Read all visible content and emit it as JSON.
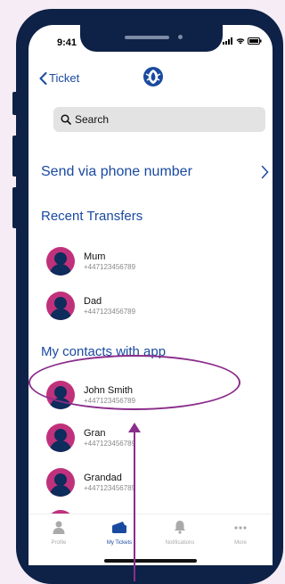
{
  "status": {
    "time": "9:41"
  },
  "nav": {
    "back_label": "Ticket"
  },
  "search": {
    "label": "Search"
  },
  "send_phone": {
    "label": "Send via phone number"
  },
  "recent": {
    "title": "Recent Transfers",
    "items": [
      {
        "name": "Mum",
        "phone": "+447123456789"
      },
      {
        "name": "Dad",
        "phone": "+447123456789"
      }
    ]
  },
  "contacts": {
    "title": "My contacts with app",
    "items": [
      {
        "name": "John Smith",
        "phone": "+447123456789"
      },
      {
        "name": "Gran",
        "phone": "+447123456789"
      },
      {
        "name": "Grandad",
        "phone": "+447123456789"
      }
    ]
  },
  "tabs": [
    {
      "label": "Profile",
      "icon": "profile-icon"
    },
    {
      "label": "My Tickets",
      "icon": "tickets-icon"
    },
    {
      "label": "Notifications",
      "icon": "bell-icon"
    },
    {
      "label": "More",
      "icon": "more-icon"
    }
  ],
  "colors": {
    "accent": "#1a4aa0",
    "avatar": "#c0317c",
    "annotation": "#8b2d8b",
    "frame": "#0e2146"
  }
}
